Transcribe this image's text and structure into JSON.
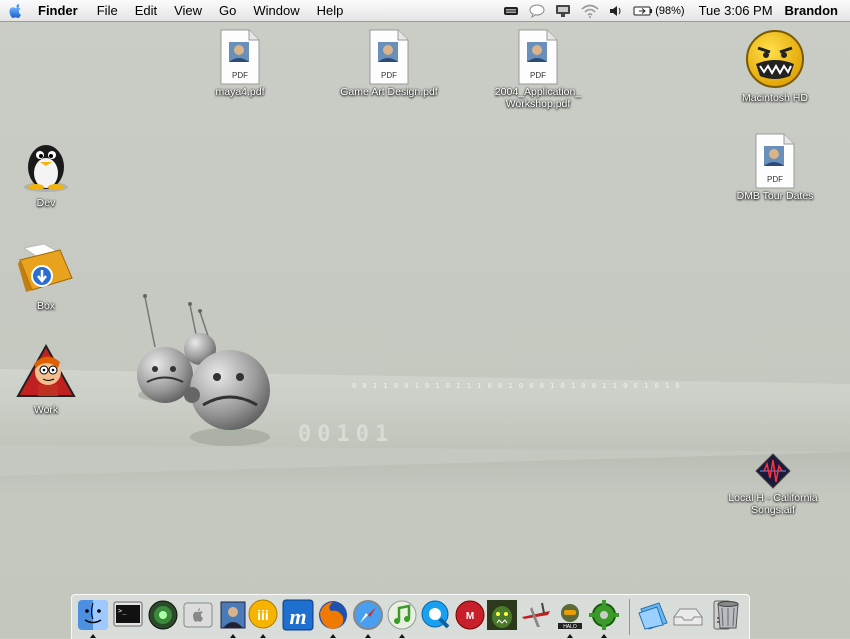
{
  "menubar": {
    "app": "Finder",
    "menus": [
      "File",
      "Edit",
      "View",
      "Go",
      "Window",
      "Help"
    ],
    "battery": "(98%)",
    "clock": "Tue 3:06 PM",
    "user": "Brandon"
  },
  "desktop": {
    "icons": [
      {
        "label": "maya4.pdf",
        "type": "pdf"
      },
      {
        "label": "Game Art Design.pdf",
        "type": "pdf"
      },
      {
        "label": "2004_Application_Workshop.pdf",
        "type": "pdf"
      },
      {
        "label": "Macintosh HD",
        "type": "hd"
      },
      {
        "label": "DMB Tour Dates",
        "type": "pdf"
      },
      {
        "label": "Dev",
        "type": "folder"
      },
      {
        "label": "Box",
        "type": "folder"
      },
      {
        "label": "Work",
        "type": "folder"
      },
      {
        "label": "Local H - California Songs.aif",
        "type": "audio"
      }
    ],
    "pdf_badge": "PDF",
    "wallpaper_binary": "0 0 1 1 0 0 1 0 1 0 1 1 1 0 0 1 0 0 0 1 0 1 0 0 1 1 0 0 1 0 1 0",
    "wallpaper_big": "00101"
  },
  "dock": {
    "items": [
      {
        "name": "Finder",
        "running": true
      },
      {
        "name": "Terminal",
        "running": false
      },
      {
        "name": "Network Utility",
        "running": false
      },
      {
        "name": "System Preferences",
        "running": false
      },
      {
        "name": "Preview",
        "running": true
      },
      {
        "name": "iChat",
        "running": true
      },
      {
        "name": "Maya",
        "running": false
      },
      {
        "name": "Firefox",
        "running": true
      },
      {
        "name": "Safari",
        "running": true
      },
      {
        "name": "iTunes",
        "running": true
      },
      {
        "name": "QuickTime",
        "running": false
      },
      {
        "name": "Maya 2",
        "running": false
      },
      {
        "name": "Warcraft",
        "running": false
      },
      {
        "name": "Airplane",
        "running": false
      },
      {
        "name": "Halo",
        "running": true
      },
      {
        "name": "Puzzle",
        "running": true
      },
      {
        "name": "Documents",
        "running": false
      },
      {
        "name": "Mail",
        "running": false
      },
      {
        "name": "Server",
        "running": false
      },
      {
        "name": "Trash",
        "running": false
      }
    ]
  },
  "colors": {
    "menubar": "#ececec",
    "desktop": "#c8ccc4",
    "label_shadow": "#000000"
  }
}
